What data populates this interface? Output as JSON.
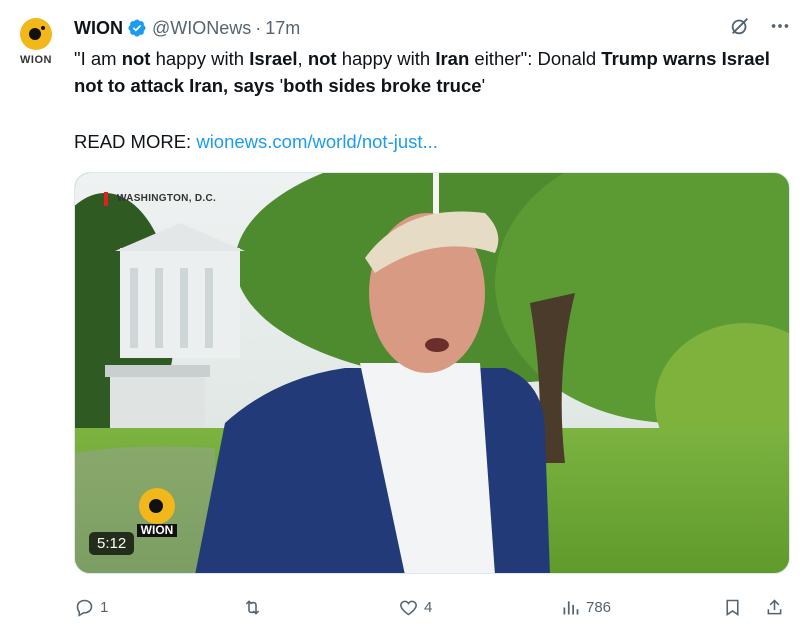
{
  "account": {
    "avatar_text": "WION",
    "display_name": "WION",
    "handle": "@WIONews",
    "separator": "·",
    "time": "17m"
  },
  "tweet": {
    "text_parts": [
      {
        "t": "\"I am ",
        "b": false
      },
      {
        "t": "not",
        "b": true
      },
      {
        "t": " happy with ",
        "b": false
      },
      {
        "t": "Israel",
        "b": true
      },
      {
        "t": ", ",
        "b": false
      },
      {
        "t": "not",
        "b": true
      },
      {
        "t": " happy with ",
        "b": false
      },
      {
        "t": "Iran",
        "b": true
      },
      {
        "t": " either\": Donald ",
        "b": false
      },
      {
        "t": "Trump",
        "b": true
      },
      {
        "t": " ",
        "b": false
      },
      {
        "t": "warns Israel not to attack Iran, says",
        "b": true
      },
      {
        "t": " '",
        "b": false
      },
      {
        "t": "both sides broke truce",
        "b": true
      },
      {
        "t": "'",
        "b": false
      }
    ],
    "readmore_label": "READ MORE: ",
    "readmore_link": "wionews.com/world/not-just..."
  },
  "media": {
    "location": "WASHINGTON, D.C.",
    "logo_text": "WION",
    "duration": "5:12"
  },
  "actions": {
    "reply_count": "1",
    "retweet_count": "",
    "like_count": "4",
    "views_count": "786"
  },
  "icons": [
    "verified-icon",
    "grok-icon",
    "more-icon",
    "reply-icon",
    "retweet-icon",
    "like-icon",
    "views-icon",
    "bookmark-icon",
    "share-icon"
  ],
  "colors": {
    "accent": "#1d9bf0",
    "secondary_text": "#536471",
    "brand": "#f2b71a"
  }
}
